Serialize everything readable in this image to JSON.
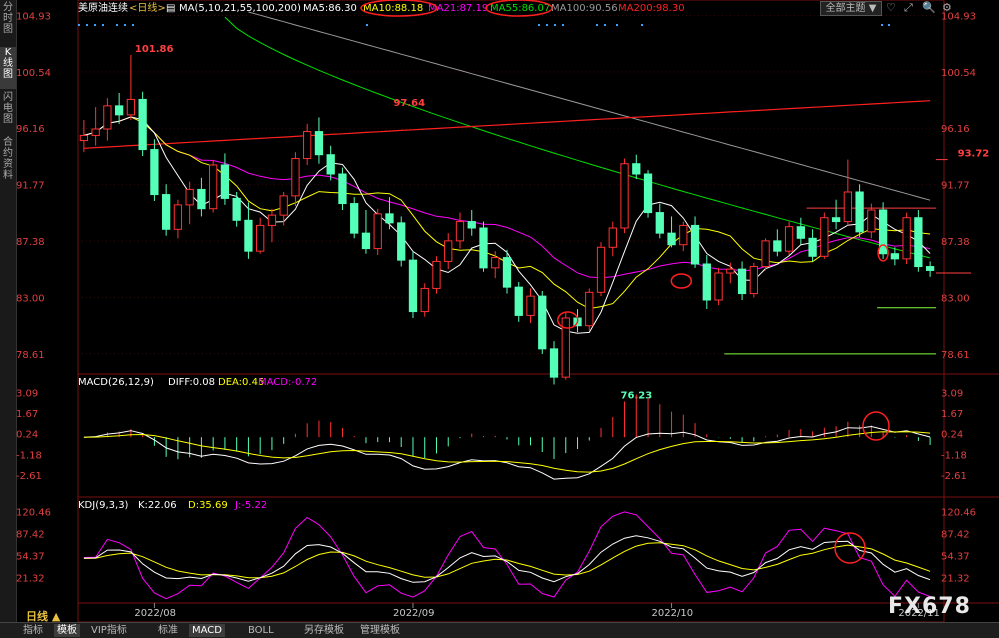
{
  "left_tabs": [
    "分时图",
    "K线图",
    "闪电图",
    "合约资料"
  ],
  "header": {
    "instrument": "美原油连续",
    "period": "<日线>",
    "ma_label": "MA(5,10,21,55,100,200)",
    "ma5": "MA5:86.30",
    "ma10": "MA10:88.18",
    "ma21": "MA21:87.19",
    "ma55": "MA55:86.07",
    "ma100": "MA100:90.56",
    "ma200": "MA200:98.30",
    "theme_button": "全部主题 ▼"
  },
  "macd": {
    "label": "MACD(26,12,9)",
    "diff": "DIFF:0.08",
    "dea": "DEA:0.45",
    "macd": "MACD:-0.72"
  },
  "kdj": {
    "label": "KDJ(9,3,3)",
    "k": "K:22.06",
    "d": "D:35.69",
    "j": "J:-5.22"
  },
  "footer": {
    "period_label": "日线 ▲",
    "tabs": [
      "指标",
      "模板",
      "VIP指标",
      "标准",
      "MACD",
      "BOLL",
      "另存模板",
      "管理模板"
    ]
  },
  "watermark": "FX678",
  "colors": {
    "up": "#ff3232",
    "down": "#54ffb8",
    "ma5": "#ffffff",
    "ma10": "#ffff00",
    "ma21": "#ff00ff",
    "ma55": "#00e000",
    "ma100": "#9a9a9a",
    "ma200": "#ff2020"
  },
  "chart_data": [
    {
      "type": "candlestick",
      "price_ticks": [
        "104.93",
        "100.54",
        "96.16",
        "91.77",
        "87.38",
        "83.00",
        "78.61"
      ],
      "ylim": [
        77.2,
        105.2
      ],
      "x_labels": [
        {
          "label": "2022/08",
          "index": 6
        },
        {
          "label": "2022/09",
          "index": 28
        },
        {
          "label": "2022/10",
          "index": 50
        },
        {
          "label": "2022/11",
          "index": 71
        }
      ],
      "annotations": [
        {
          "text": "101.86",
          "index": 4,
          "value": 101.86
        },
        {
          "text": "97.64",
          "index": 26,
          "value": 97.64
        },
        {
          "text": "76.23",
          "index": 46,
          "value": 76.23
        },
        {
          "text": "93.72",
          "index": 74,
          "value": 93.72
        }
      ],
      "hlines": [
        {
          "value": 93.72,
          "from": 74,
          "color": "#ff4040"
        },
        {
          "value": 89.95,
          "from": 62,
          "color": "#ff4040"
        },
        {
          "value": 84.9,
          "from": 76,
          "color": "#ff4040"
        },
        {
          "value": 82.2,
          "from": 68,
          "color": "#80ff40"
        },
        {
          "value": 78.61,
          "from": 55,
          "color": "#80ff40"
        }
      ],
      "candles": [
        [
          95.2,
          96.8,
          94.3,
          95.6
        ],
        [
          95.6,
          97.8,
          94.8,
          96.1
        ],
        [
          96.1,
          98.5,
          95.2,
          97.9
        ],
        [
          97.9,
          98.9,
          96.5,
          97.2
        ],
        [
          97.2,
          101.86,
          96.8,
          98.4
        ],
        [
          98.4,
          99.0,
          94.0,
          94.5
        ],
        [
          94.5,
          95.3,
          90.5,
          91.0
        ],
        [
          91.0,
          91.8,
          87.8,
          88.3
        ],
        [
          88.3,
          90.6,
          87.6,
          90.2
        ],
        [
          90.2,
          92.0,
          88.7,
          91.4
        ],
        [
          91.4,
          92.3,
          89.3,
          89.9
        ],
        [
          89.9,
          93.7,
          89.6,
          93.3
        ],
        [
          93.3,
          94.2,
          90.2,
          90.7
        ],
        [
          90.7,
          91.2,
          88.5,
          89.0
        ],
        [
          89.0,
          90.4,
          86.0,
          86.6
        ],
        [
          86.6,
          89.2,
          86.4,
          88.6
        ],
        [
          88.6,
          89.9,
          87.3,
          89.4
        ],
        [
          89.4,
          91.2,
          88.6,
          90.9
        ],
        [
          90.9,
          94.3,
          90.1,
          93.8
        ],
        [
          93.8,
          96.5,
          93.3,
          95.9
        ],
        [
          95.9,
          97.0,
          93.4,
          94.1
        ],
        [
          94.1,
          94.8,
          92.1,
          92.6
        ],
        [
          92.6,
          93.1,
          89.8,
          90.3
        ],
        [
          90.3,
          90.8,
          87.6,
          88.0
        ],
        [
          88.0,
          89.8,
          86.4,
          86.8
        ],
        [
          86.8,
          89.9,
          86.3,
          89.5
        ],
        [
          89.5,
          90.8,
          88.3,
          88.8
        ],
        [
          88.8,
          89.3,
          85.4,
          85.9
        ],
        [
          85.9,
          86.6,
          81.4,
          81.9
        ],
        [
          81.9,
          84.1,
          81.5,
          83.7
        ],
        [
          83.7,
          86.2,
          83.3,
          85.8
        ],
        [
          85.8,
          88.0,
          85.2,
          87.4
        ],
        [
          87.4,
          89.6,
          86.8,
          88.9
        ],
        [
          88.9,
          89.8,
          87.8,
          88.4
        ],
        [
          88.4,
          88.9,
          85.0,
          85.3
        ],
        [
          85.3,
          86.6,
          84.5,
          86.1
        ],
        [
          86.1,
          86.7,
          83.3,
          83.8
        ],
        [
          83.8,
          84.2,
          81.1,
          81.6
        ],
        [
          81.6,
          83.7,
          81.0,
          83.1
        ],
        [
          83.1,
          83.5,
          78.6,
          79.0
        ],
        [
          79.0,
          79.6,
          76.23,
          76.8
        ],
        [
          76.8,
          81.8,
          76.6,
          81.4
        ],
        [
          81.4,
          82.1,
          80.3,
          80.8
        ],
        [
          80.8,
          83.7,
          80.4,
          83.4
        ],
        [
          83.4,
          87.3,
          83.1,
          86.9
        ],
        [
          86.9,
          88.9,
          86.2,
          88.4
        ],
        [
          88.4,
          93.8,
          88.0,
          93.4
        ],
        [
          93.4,
          94.1,
          92.2,
          92.6
        ],
        [
          92.6,
          92.9,
          89.2,
          89.6
        ],
        [
          89.6,
          90.3,
          87.6,
          88.0
        ],
        [
          88.0,
          89.3,
          86.9,
          87.1
        ],
        [
          87.1,
          88.9,
          86.6,
          88.6
        ],
        [
          88.6,
          89.3,
          85.3,
          85.6
        ],
        [
          85.6,
          86.3,
          82.1,
          82.8
        ],
        [
          82.8,
          85.3,
          82.4,
          84.9
        ],
        [
          84.9,
          85.7,
          84.1,
          85.2
        ],
        [
          85.2,
          85.8,
          82.8,
          83.3
        ],
        [
          83.3,
          85.7,
          83.0,
          85.4
        ],
        [
          85.4,
          87.6,
          85.1,
          87.4
        ],
        [
          87.4,
          88.3,
          86.2,
          86.6
        ],
        [
          86.6,
          88.9,
          86.3,
          88.5
        ],
        [
          88.5,
          89.2,
          87.1,
          87.6
        ],
        [
          87.6,
          88.3,
          85.8,
          86.2
        ],
        [
          86.2,
          89.6,
          86.0,
          89.2
        ],
        [
          89.2,
          90.6,
          88.3,
          88.9
        ],
        [
          88.9,
          93.72,
          88.6,
          91.2
        ],
        [
          91.2,
          91.8,
          87.7,
          88.1
        ],
        [
          88.1,
          90.3,
          87.6,
          89.8
        ],
        [
          89.8,
          90.4,
          86.0,
          86.4
        ],
        [
          86.4,
          86.9,
          85.5,
          86.0
        ],
        [
          86.0,
          89.6,
          85.6,
          89.2
        ],
        [
          89.2,
          89.8,
          85.0,
          85.4
        ],
        [
          85.4,
          85.8,
          84.6,
          85.1
        ]
      ]
    },
    {
      "type": "bar",
      "name": "MACD",
      "y_ticks": [
        "3.09",
        "1.67",
        "0.24",
        "-1.18",
        "-2.61"
      ],
      "ylim": [
        -3.3,
        3.6
      ]
    },
    {
      "type": "line",
      "name": "KDJ",
      "y_ticks": [
        "120.46",
        "87.42",
        "54.37",
        "21.32"
      ],
      "ylim": [
        -12,
        130
      ]
    }
  ]
}
